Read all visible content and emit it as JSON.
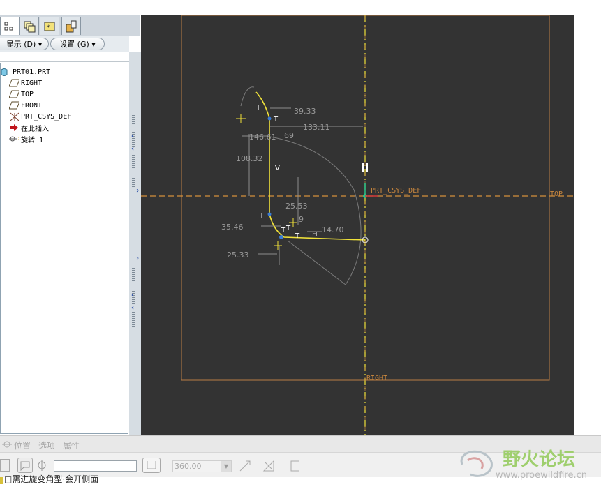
{
  "model_tree": {
    "tabs": [
      {
        "icon": "model-tree-icon"
      },
      {
        "icon": "layer-icon"
      },
      {
        "icon": "favorites-icon"
      },
      {
        "icon": "connections-icon"
      }
    ],
    "show_menu_label": "显示 (D) ▾",
    "settings_menu_label": "设置 (G) ▾",
    "items": [
      {
        "label": "PRT01.PRT",
        "icon": "part-icon"
      },
      {
        "label": "RIGHT",
        "icon": "datum-plane-icon"
      },
      {
        "label": "TOP",
        "icon": "datum-plane-icon"
      },
      {
        "label": "FRONT",
        "icon": "datum-plane-icon"
      },
      {
        "label": "PRT_CSYS_DEF",
        "icon": "csys-icon"
      },
      {
        "label": "在此插入",
        "icon": "insert-here-arrow-icon"
      },
      {
        "label": "旋转 1",
        "icon": "revolve-feature-icon"
      }
    ]
  },
  "sketch": {
    "csys_label": "PRT_CSYS_DEF",
    "top_plane_label": "TOP",
    "right_plane_label": "RIGHT",
    "dims": {
      "d1": "39.33",
      "d2": "133.11",
      "d3": "146.61",
      "d4": "69",
      "d5": "108.32",
      "d6": "25.53",
      "d7": "9",
      "d8": "35.46",
      "d9": "14.70",
      "d10": "25.33"
    },
    "constraints": {
      "t": "T",
      "v": "V",
      "h": "H"
    }
  },
  "dashboard": {
    "tabs": [
      "位置",
      "选项",
      "属性"
    ],
    "angle_value": "360.00",
    "angle_input_placeholder": ""
  },
  "status_line": "□需进旋变角型·会开侧面",
  "watermark": {
    "brand": "野火论坛",
    "url": "www.proewildfire.cn"
  },
  "colors": {
    "canvas_bg": "#333333",
    "sketch_yellow": "#f0e23a",
    "datum_orange": "#c9873e",
    "dimension_gray": "#8e8e8e"
  }
}
